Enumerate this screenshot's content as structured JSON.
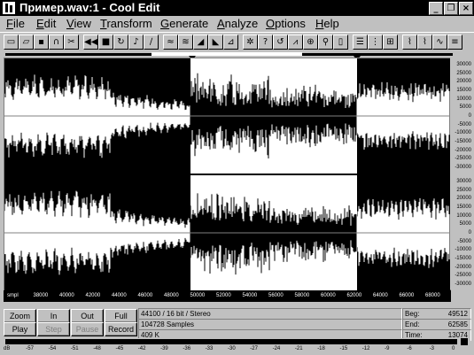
{
  "window": {
    "title": "Пример.wav:1 - Cool Edit",
    "minimize": "_",
    "restore": "❐",
    "close": "×"
  },
  "menu": [
    {
      "label": "File",
      "key": "F",
      "rest": "ile"
    },
    {
      "label": "Edit",
      "key": "E",
      "rest": "dit"
    },
    {
      "label": "View",
      "key": "V",
      "rest": "iew"
    },
    {
      "label": "Transform",
      "key": "T",
      "rest": "ransform"
    },
    {
      "label": "Generate",
      "key": "G",
      "rest": "enerate"
    },
    {
      "label": "Analyze",
      "key": "A",
      "rest": "nalyze"
    },
    {
      "label": "Options",
      "key": "O",
      "rest": "ptions"
    },
    {
      "label": "Help",
      "key": "H",
      "rest": "elp"
    }
  ],
  "toolbar": [
    {
      "icon": "new-file-icon",
      "glyph": "▭"
    },
    {
      "icon": "open-file-icon",
      "glyph": "▱"
    },
    {
      "icon": "save-icon",
      "glyph": "▪"
    },
    {
      "icon": "headphones-icon",
      "glyph": "∩"
    },
    {
      "icon": "cut-icon",
      "glyph": "✂"
    },
    {
      "icon": "skip-back-icon",
      "glyph": "◀◀"
    },
    {
      "icon": "stop-icon",
      "glyph": "■"
    },
    {
      "icon": "loop-icon",
      "glyph": "↻"
    },
    {
      "icon": "note-icon",
      "glyph": "♪"
    },
    {
      "icon": "waveform-edit-icon",
      "glyph": "∕"
    },
    {
      "icon": "waveform-a-icon",
      "glyph": "≈"
    },
    {
      "icon": "waveform-b-icon",
      "glyph": "≋"
    },
    {
      "icon": "fade-in-icon",
      "glyph": "◢"
    },
    {
      "icon": "fade-out-icon",
      "glyph": "◣"
    },
    {
      "icon": "amplify-icon",
      "glyph": "⊿"
    },
    {
      "icon": "gear-icon",
      "glyph": "✲"
    },
    {
      "icon": "question-icon",
      "glyph": "?"
    },
    {
      "icon": "refresh-icon",
      "glyph": "↺"
    },
    {
      "icon": "envelope-icon",
      "glyph": "⩘"
    },
    {
      "icon": "zoom-icon",
      "glyph": "⊕"
    },
    {
      "icon": "magnify-icon",
      "glyph": "⚲"
    },
    {
      "icon": "document-icon",
      "glyph": "▯"
    },
    {
      "icon": "list-icon",
      "glyph": "☰"
    },
    {
      "icon": "grid-icon",
      "glyph": "⋮"
    },
    {
      "icon": "filter-icon",
      "glyph": "⊞"
    },
    {
      "icon": "spectrum-a-icon",
      "glyph": "⌇"
    },
    {
      "icon": "spectrum-b-icon",
      "glyph": "⌇"
    },
    {
      "icon": "wave-view-icon",
      "glyph": "∿"
    },
    {
      "icon": "multi-wave-icon",
      "glyph": "≡"
    },
    {
      "icon": "spectral-icon",
      "glyph": "▦"
    }
  ],
  "amp_labels": [
    "30000",
    "25000",
    "20000",
    "15000",
    "10000",
    "5000",
    "0",
    "-5000",
    "-10000",
    "-15000",
    "-20000",
    "-25000",
    "-30000"
  ],
  "amp_labels_ch2": [
    "30000",
    "25000",
    "20000",
    "15000",
    "10000",
    "5000",
    "0",
    "-5000",
    "-10000",
    "-15000",
    "-20000",
    "-25000",
    "-30000"
  ],
  "time_labels": [
    "smpl",
    "38000",
    "40000",
    "42000",
    "44000",
    "46000",
    "48000",
    "50000",
    "52000",
    "54000",
    "56000",
    "58000",
    "60000",
    "62000",
    "64000",
    "66000",
    "68000"
  ],
  "controls": {
    "zoom": "Zoom",
    "in": "In",
    "out": "Out",
    "full": "Full",
    "play": "Play",
    "step": "Step",
    "pause": "Pause",
    "record": "Record"
  },
  "info": {
    "format": "44100 / 16 bit / Stereo",
    "samples": "104728 Samples",
    "size": "409 K",
    "beg_label": "Beg:",
    "beg_value": "49512",
    "end_label": "End:",
    "end_value": "62585",
    "time_label": "Time:",
    "time_value": "13074"
  },
  "db_labels": [
    "dB",
    "-57",
    "-54",
    "-51",
    "-48",
    "-45",
    "-42",
    "-39",
    "-36",
    "-33",
    "-30",
    "-27",
    "-24",
    "-21",
    "-18",
    "-15",
    "-12",
    "-9",
    "-6",
    "-3",
    "0"
  ]
}
